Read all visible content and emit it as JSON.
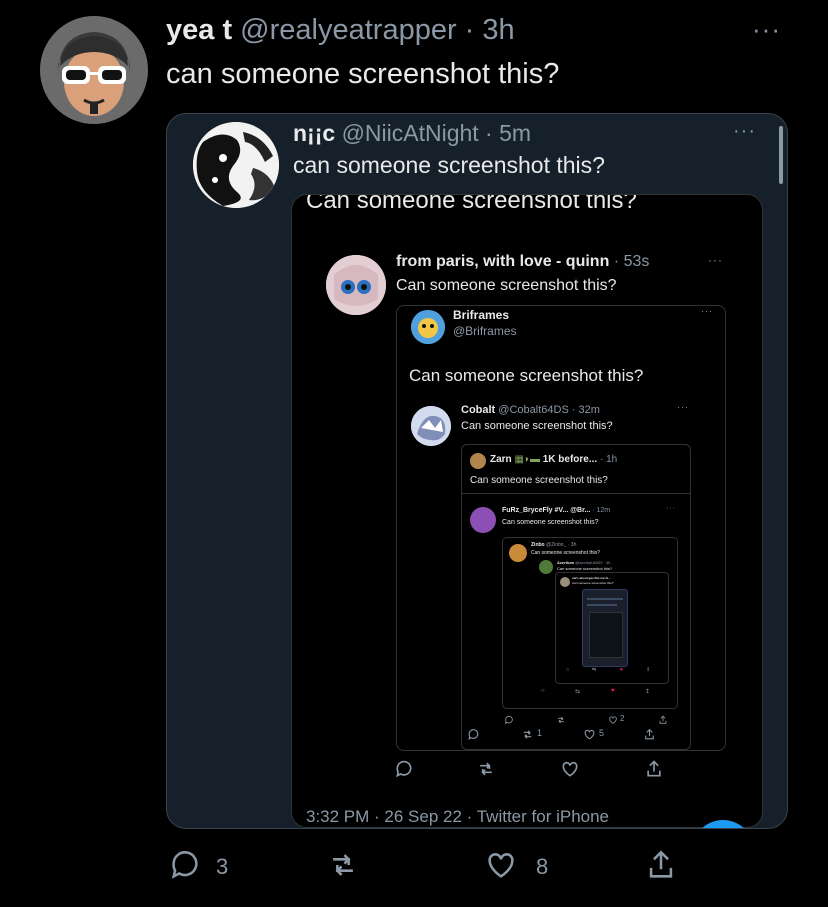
{
  "outer": {
    "display_name": "yea t",
    "handle_time": "@realyeatrapper · 3h",
    "text": "can someone screenshot this?",
    "more": "···",
    "counts": {
      "reply": "3",
      "like": "8"
    }
  },
  "quoted": {
    "display_name": "n¡¡c",
    "handle_time": "@NiicAtNight · 5m",
    "text": "can someone screenshot this?",
    "more": "···",
    "image": {
      "top_text": "Can someone screenshot this?",
      "footer": "3:32 PM · 26 Sep 22 · Twitter for iPhone",
      "l1": {
        "name": "from paris, with love - quinn",
        "time": "· 53s",
        "text": "Can someone screenshot this?",
        "more": "···"
      },
      "l2": {
        "name": "Briframes",
        "handle": "@Briframes",
        "text": "Can someone screenshot this?",
        "more": "···"
      },
      "l3": {
        "name": "Cobalt",
        "handle_time": "@Cobalt64DS · 32m",
        "text": "Can someone screenshot this?",
        "more": "···",
        "counts": {
          "retweet": "1",
          "like": "5"
        }
      },
      "l4": {
        "name": "Zarn",
        "extra": "1K before...",
        "time": "· 1h",
        "text": "Can someone screenshot this?"
      },
      "l5": {
        "name": "FuRz_BryceFly",
        "extra": "#V... @Br...",
        "time": "· 12m",
        "text": "Can someone screenshot this?",
        "more": "···",
        "counts": {
          "like": "2"
        }
      },
      "l6": {
        "name": "Zinbo",
        "handle_time": "@Zinbo_ · 3h",
        "text": "Can someone screenshot this?"
      },
      "l7": {
        "name": "Azertium",
        "handle_time": "@azertyfu5000 · 4h",
        "text": "Can someone screenshot this?"
      },
      "l8": {
        "name": "cat's about gas like me fe...",
        "text": "Can someone screenshot this?"
      }
    }
  },
  "colors": {
    "background": "#000000",
    "card": "#15202b",
    "border": "#38444d",
    "muted": "#8b98a5",
    "like_red": "#f91880"
  },
  "icons": [
    "reply-icon",
    "retweet-icon",
    "like-icon",
    "share-icon",
    "more-icon"
  ]
}
